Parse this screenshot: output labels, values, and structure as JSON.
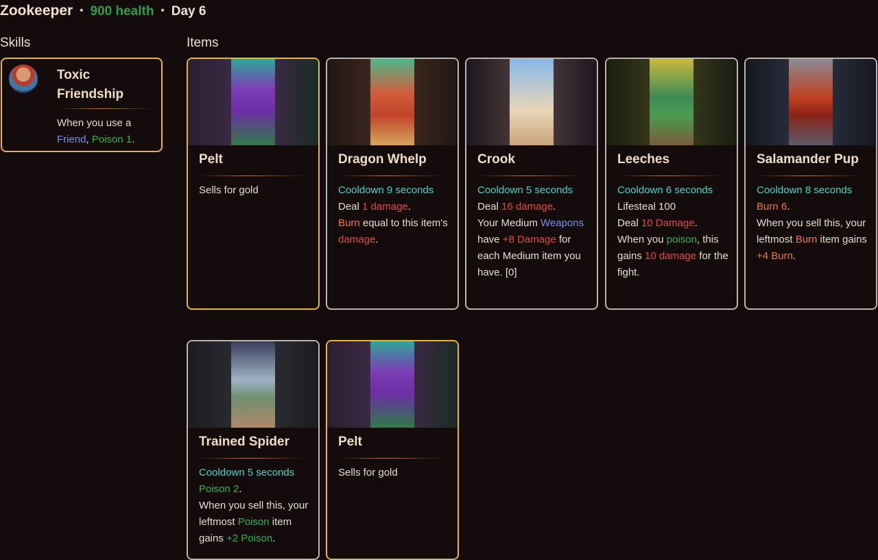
{
  "header": {
    "name": "Zookeeper",
    "health": "900 health",
    "day": "Day 6",
    "separator": "•"
  },
  "sections": {
    "skills": "Skills",
    "items": "Items"
  },
  "colors": {
    "background": "#140c0c",
    "gold_border": "#e8b931",
    "silver_border": "#bdb7b2",
    "health": "#2f9e4a",
    "cooldown": "#45d6c6",
    "damage": "#e7473d",
    "burn": "#f07a3d",
    "poison": "#2fb54a",
    "friend": "#7b8ff0"
  },
  "skill": {
    "icon": "zookeeper-portrait",
    "title": "Toxic Friendship",
    "desc": {
      "pre": "When you use a ",
      "friend": "Friend",
      "comma": ", ",
      "poison": "Poison 1",
      "end": "."
    }
  },
  "items": [
    {
      "title": "Pelt",
      "line1": "Sells for gold"
    },
    {
      "title": "Dragon Whelp",
      "cooldown": "Cooldown 9 seconds",
      "deal": "Deal ",
      "damage": "1 damage",
      "period": ".",
      "burn": "Burn",
      "burn_rest": " equal to this item's ",
      "damage2": "damage",
      "period2": "."
    },
    {
      "title": "Crook",
      "cooldown": "Cooldown 5 seconds",
      "deal": "Deal ",
      "damage": "16 damage",
      "period": ".",
      "line3": "Your Medium ",
      "weapons": "Weapons",
      "have": " have ",
      "bonus": "+8 Damage",
      "rest": " for each Medium item you have. [0]"
    },
    {
      "title": "Leeches",
      "cooldown": "Cooldown 6 seconds",
      "lifesteal": "Lifesteal 100",
      "deal": "Deal ",
      "damage": "10 Damage",
      "period": ".",
      "when": "When you ",
      "poison": "poison",
      "gains": ", this gains ",
      "damage2": "10 damage",
      "rest": " for the fight."
    },
    {
      "title": "Salamander Pup",
      "cooldown": "Cooldown 8 seconds",
      "burn": "Burn 6",
      "period": ".",
      "when": "When you sell this, your leftmost ",
      "burn2": "Burn",
      "gains": " item gains ",
      "bonus": "+4 Burn",
      "period2": "."
    },
    {
      "title": "Trained Spider",
      "cooldown": "Cooldown 5 seconds",
      "poison": "Poison 2",
      "period": ".",
      "when": "When you sell this, your leftmost ",
      "poison2": "Poison",
      "gains": " item gains ",
      "bonus": "+2 Poison",
      "period2": "."
    },
    {
      "title": "Pelt",
      "line1": "Sells for gold"
    }
  ]
}
